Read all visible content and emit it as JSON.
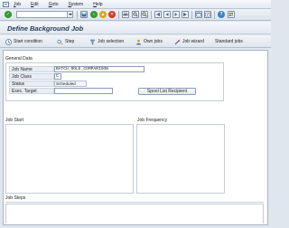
{
  "menu": {
    "items": [
      "Job",
      "Edit",
      "Goto",
      "System",
      "Help"
    ]
  },
  "title": {
    "text": "Define Background Job"
  },
  "app_toolbar": {
    "items": [
      {
        "label": "Start condition",
        "icon": "clock-icon"
      },
      {
        "label": "Step",
        "icon": "step-icon"
      },
      {
        "label": "Job selection",
        "icon": "job-selection-icon"
      },
      {
        "label": "Own jobs",
        "icon": "own-jobs-icon"
      },
      {
        "label": "Job wizard",
        "icon": "wand-icon"
      },
      {
        "label": "Standard jobs",
        "icon": ""
      }
    ]
  },
  "general_data": {
    "heading": "General Data",
    "fields": [
      {
        "label": "Job Name",
        "value": "BATCH_ROLE_COMPARISON"
      },
      {
        "label": "Job Class",
        "value": "C"
      },
      {
        "label": "Status",
        "value": "Scheduled"
      },
      {
        "label": "Exec. Target",
        "value": ""
      }
    ],
    "spool_button": "Spool List Recipient"
  },
  "sections": {
    "job_start": "Job Start",
    "job_frequency": "Job Frequency",
    "job_steps": "Job Steps"
  },
  "colors": {
    "enter_green": "#2f9a2f",
    "cancel_red": "#d23a2a",
    "back_yellow": "#e0a511",
    "title_blue": "#1f3a57"
  }
}
